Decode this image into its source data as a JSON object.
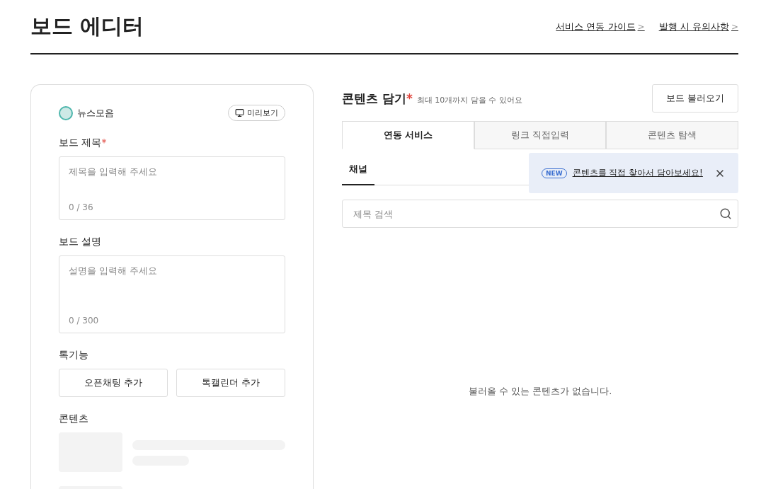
{
  "header": {
    "title": "보드 에디터",
    "links": [
      {
        "label": "서비스 연동 가이드",
        "arrow": ">"
      },
      {
        "label": "발행 시 유의사항",
        "arrow": ">"
      }
    ]
  },
  "editor": {
    "channel": {
      "name": "뉴스모음"
    },
    "preview_button": "미리보기",
    "title_field": {
      "label": "보드 제목",
      "required": "*",
      "placeholder": "제목을 입력해 주세요",
      "counter": "0 / 36"
    },
    "description_field": {
      "label": "보드 설명",
      "placeholder": "설명을 입력해 주세요",
      "counter": "0 / 300"
    },
    "talk_features": {
      "label": "톡기능",
      "buttons": [
        "오픈채팅 추가",
        "톡캘린더 추가"
      ]
    },
    "contents": {
      "label": "콘텐츠"
    }
  },
  "content_panel": {
    "title": "콘텐츠 담기",
    "required": "*",
    "hint": "최대 10개까지 담을 수 있어요",
    "load_button": "보드 불러오기",
    "tabs": [
      {
        "label": "연동 서비스",
        "selected": true
      },
      {
        "label": "링크 직접입력",
        "selected": false
      },
      {
        "label": "콘텐츠 탐색",
        "selected": false
      }
    ],
    "sub_tabs": [
      {
        "label": "채널",
        "selected": true
      }
    ],
    "tooltip": {
      "badge": "NEW",
      "text": "콘텐츠를 직접 찾아서 담아보세요!"
    },
    "search": {
      "placeholder": "제목 검색"
    },
    "empty_message": "불러올 수 있는 콘텐츠가 없습니다."
  }
}
